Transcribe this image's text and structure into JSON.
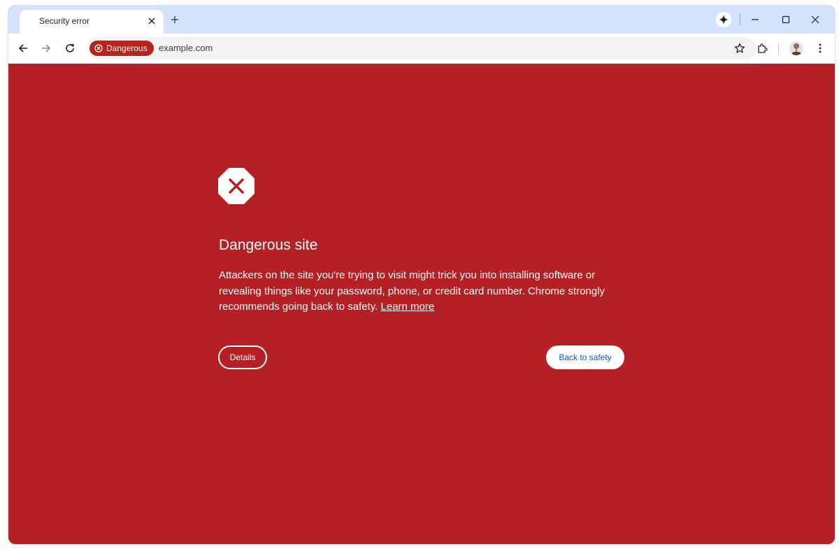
{
  "colors": {
    "danger_red": "#b52025",
    "chip_red": "#b3261e",
    "tabstrip": "#d3e3fd",
    "link_blue": "#0b57d0"
  },
  "tab": {
    "title": "Security error",
    "close_icon": "close-icon"
  },
  "toolbar": {
    "security_chip_label": "Dangerous",
    "url": "example.com"
  },
  "interstitial": {
    "icon": "danger-octagon-icon",
    "heading": "Dangerous site",
    "body": "Attackers on the site you're trying to visit might trick you into installing software or revealing things like your password, phone, or credit card number. Chrome strongly recommends going back to safety.",
    "learn_more": "Learn more",
    "details_button": "Details",
    "back_button": "Back to safety"
  }
}
